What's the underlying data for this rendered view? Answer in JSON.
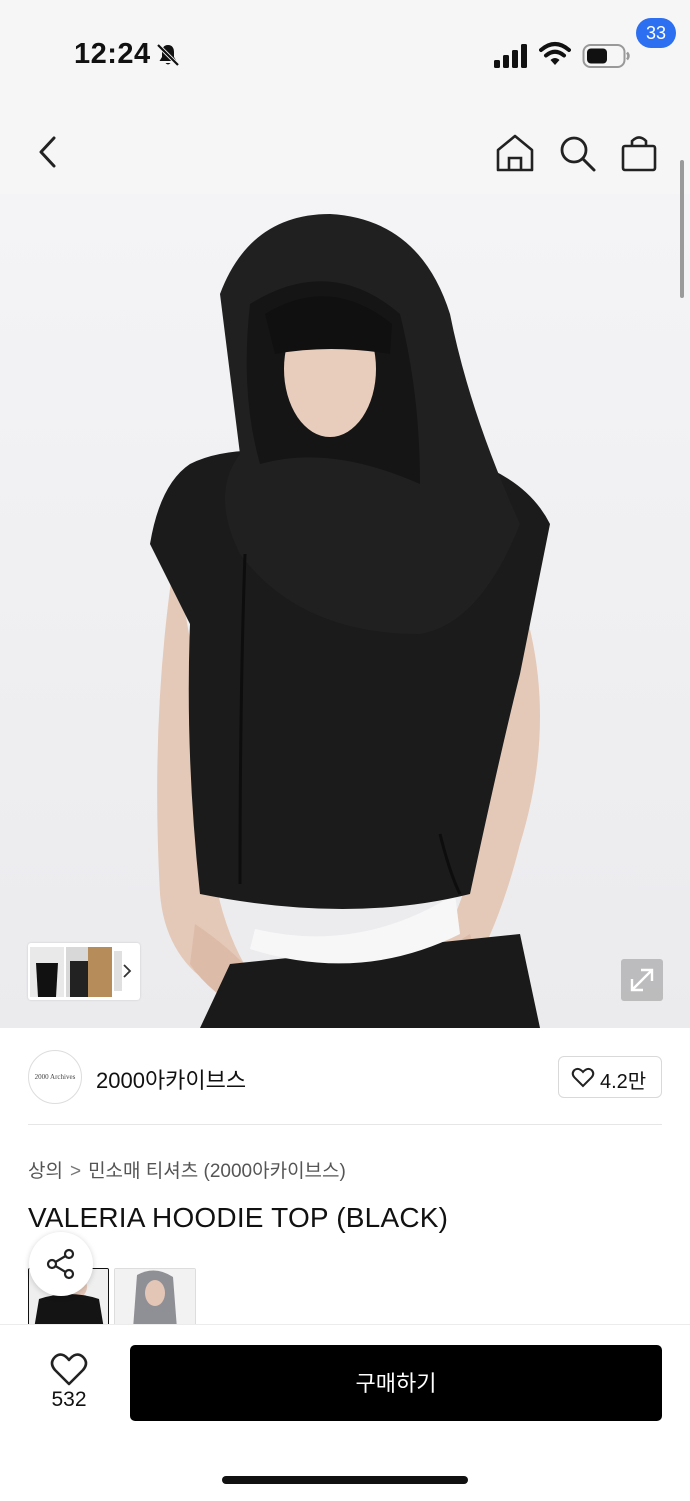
{
  "status_bar": {
    "time": "12:24"
  },
  "nav": {
    "cart_count": "33"
  },
  "brand": {
    "logo_text": "2000 Archives",
    "name": "2000아카이브스",
    "like_count": "4.2만"
  },
  "breadcrumb": {
    "category": "상의",
    "subcategory": "민소매 티셔츠 (2000아카이브스)"
  },
  "product": {
    "title": "VALERIA HOODIE TOP (BLACK)"
  },
  "bottom_bar": {
    "wish_count": "532",
    "buy_label": "구매하기"
  },
  "colors": {
    "accent_badge": "#2c6ff0",
    "buy_button": "#000000"
  }
}
